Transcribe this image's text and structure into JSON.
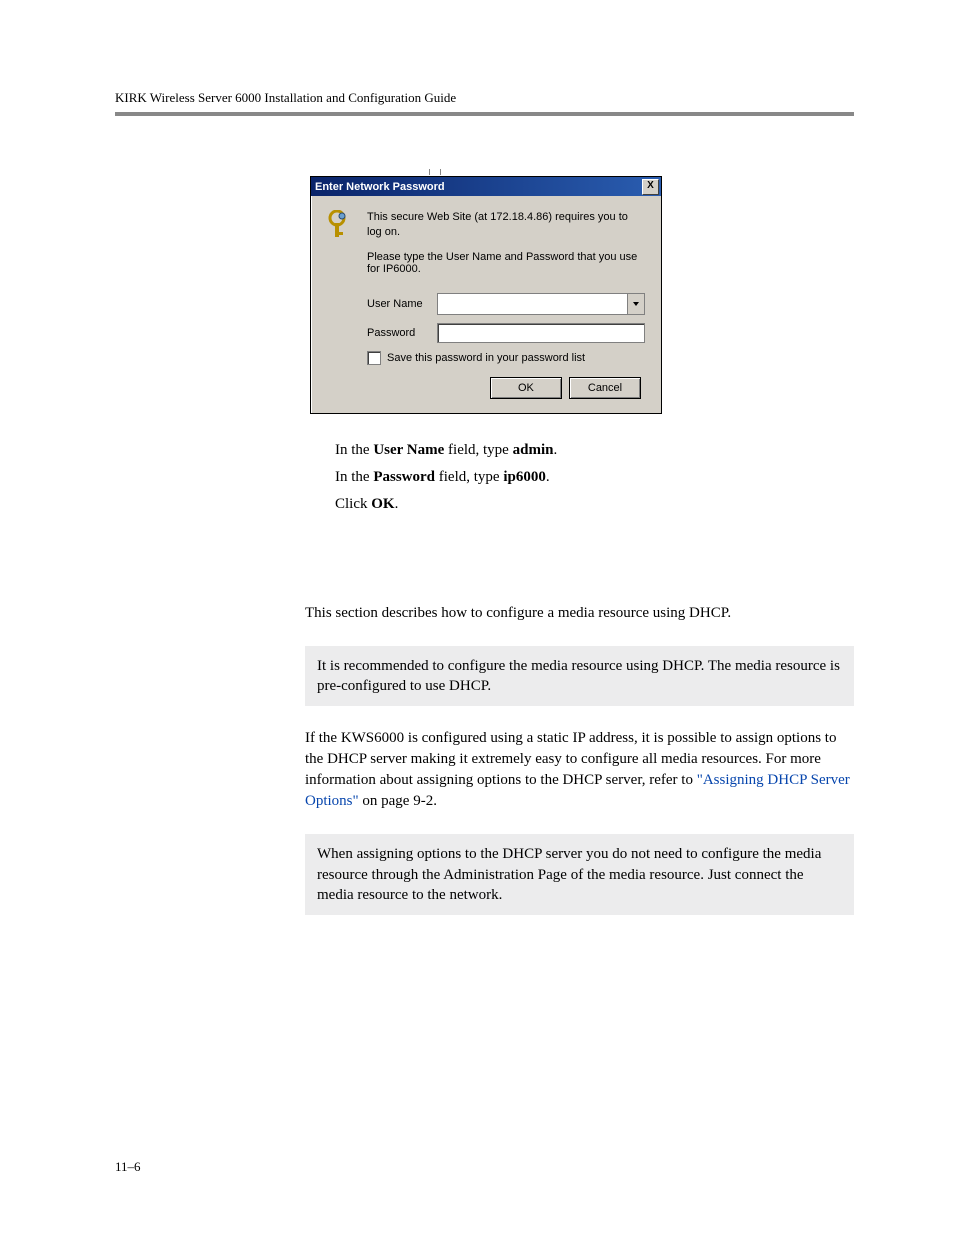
{
  "header": "KIRK Wireless Server 6000 Installation and Configuration Guide",
  "dialog": {
    "title": "Enter Network Password",
    "close_label": "X",
    "line1": "This secure Web Site (at 172.18.4.86) requires you to log on.",
    "line2": "Please type the User Name and Password that you use for IP6000.",
    "user_label": "User Name",
    "password_label": "Password",
    "save_label": "Save this password in your password list",
    "ok": "OK",
    "cancel": "Cancel"
  },
  "steps": {
    "s1a": "In the ",
    "s1b": "User Name",
    "s1c": " field, type ",
    "s1d": "admin",
    "s1e": ".",
    "s2a": "In the ",
    "s2b": "Password",
    "s2c": " field, type ",
    "s2d": "ip6000",
    "s2e": ".",
    "s3a": "Click ",
    "s3b": "OK",
    "s3c": "."
  },
  "section": {
    "intro": "This section describes how to configure a media resource using DHCP.",
    "note1": "It is recommended to configure the media resource using DHCP. The media resource is pre-configured to use DHCP.",
    "para_a": "If the KWS6000 is configured using a static IP address, it is possible to assign options to the DHCP server making it extremely easy to configure all media resources. For more information about assigning options to the DHCP server, refer to ",
    "para_link": "\"Assigning DHCP Server Options\"",
    "para_b": " on page 9-2.",
    "note2": "When assigning options to the DHCP server you do not need to configure the media resource through the Administration Page of the media resource. Just connect the media resource to the network."
  },
  "page_num": "11–6"
}
